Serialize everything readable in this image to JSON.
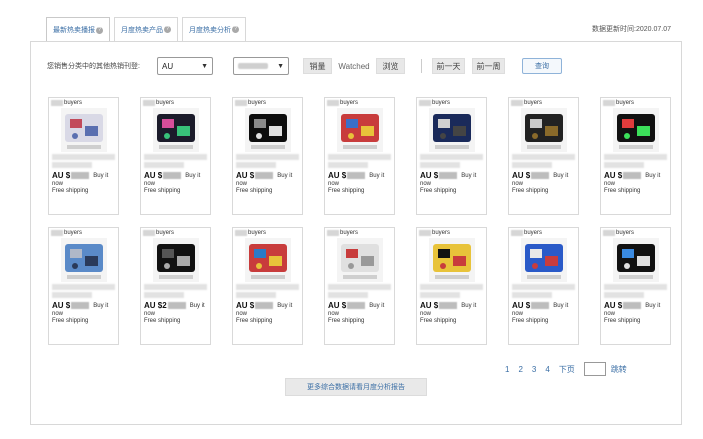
{
  "tabs": [
    {
      "label": "最新热卖播报",
      "active": true
    },
    {
      "label": "月度热卖产品",
      "active": false
    },
    {
      "label": "月度热卖分析",
      "active": false
    }
  ],
  "update_time": "数据更新时间:2020.07.07",
  "filter": {
    "label": "您销售分类中的其他热销刊登:",
    "country_value": "AU",
    "category_value": "",
    "sort_sales": "销量",
    "sort_watched": "Watched",
    "sort_views": "浏览",
    "prev_day": "前一天",
    "prev_week": "前一周",
    "query": "查询"
  },
  "cards": [
    {
      "buyers": "buyers",
      "price_prefix": "AU $",
      "buy": "Buy it",
      "now": "now",
      "shipping": "Free shipping",
      "icon": "connector-product"
    },
    {
      "buyers": "buyers",
      "price_prefix": "AU $",
      "buy": "Buy it",
      "now": "now",
      "shipping": "Free shipping",
      "icon": "led-strip-product"
    },
    {
      "buyers": "buyers",
      "price_prefix": "AU $",
      "buy": "Buy it",
      "now": "now",
      "shipping": "Free shipping",
      "icon": "led-reel-product"
    },
    {
      "buyers": "buyers",
      "price_prefix": "AU $",
      "buy": "Buy it",
      "now": "now",
      "shipping": "Free shipping",
      "icon": "terminal-assortment-product"
    },
    {
      "buyers": "buyers",
      "price_prefix": "AU $",
      "buy": "Buy it",
      "now": "now",
      "shipping": "Free shipping",
      "icon": "light-bar-product"
    },
    {
      "buyers": "buyers",
      "price_prefix": "AU $",
      "buy": "Buy it",
      "now": "now",
      "shipping": "Free shipping",
      "icon": "bulb-set-product"
    },
    {
      "buyers": "buyers",
      "price_prefix": "AU $",
      "buy": "Buy it",
      "now": "now",
      "shipping": "Free shipping",
      "icon": "rgb-kit-product"
    },
    {
      "buyers": "buyers",
      "price_prefix": "AU $",
      "buy": "Buy it",
      "now": "now",
      "shipping": "Free shipping",
      "icon": "aluminium-channel-product"
    },
    {
      "buyers": "buyers",
      "price_prefix": "AU $2",
      "buy": "Buy it",
      "now": "now",
      "shipping": "Free shipping",
      "icon": "black-tube-product"
    },
    {
      "buyers": "buyers",
      "price_prefix": "AU $",
      "buy": "Buy it",
      "now": "now",
      "shipping": "Free shipping",
      "icon": "fuse-box-product"
    },
    {
      "buyers": "buyers",
      "price_prefix": "AU $",
      "buy": "Buy it",
      "now": "now",
      "shipping": "Free shipping",
      "icon": "fuse-assortment-product"
    },
    {
      "buyers": "buyers",
      "price_prefix": "AU $",
      "buy": "Buy it",
      "now": "now",
      "shipping": "Free shipping",
      "icon": "driving-lights-product"
    },
    {
      "buyers": "buyers",
      "price_prefix": "AU $",
      "buy": "Buy it",
      "now": "now",
      "shipping": "Free shipping",
      "icon": "headlight-kit-product"
    },
    {
      "buyers": "buyers",
      "price_prefix": "AU $",
      "buy": "Buy it",
      "now": "now",
      "shipping": "Free shipping",
      "icon": "led-bulb-kit-product"
    }
  ],
  "pager": {
    "p1": "1",
    "p2": "2",
    "p3": "3",
    "p4": "4",
    "next": "下页",
    "jump": "跳转"
  },
  "more_button": "更多综合数据请看月度分析报告",
  "colors": {
    "link": "#3a6ea5",
    "border": "#d8d8d8"
  }
}
